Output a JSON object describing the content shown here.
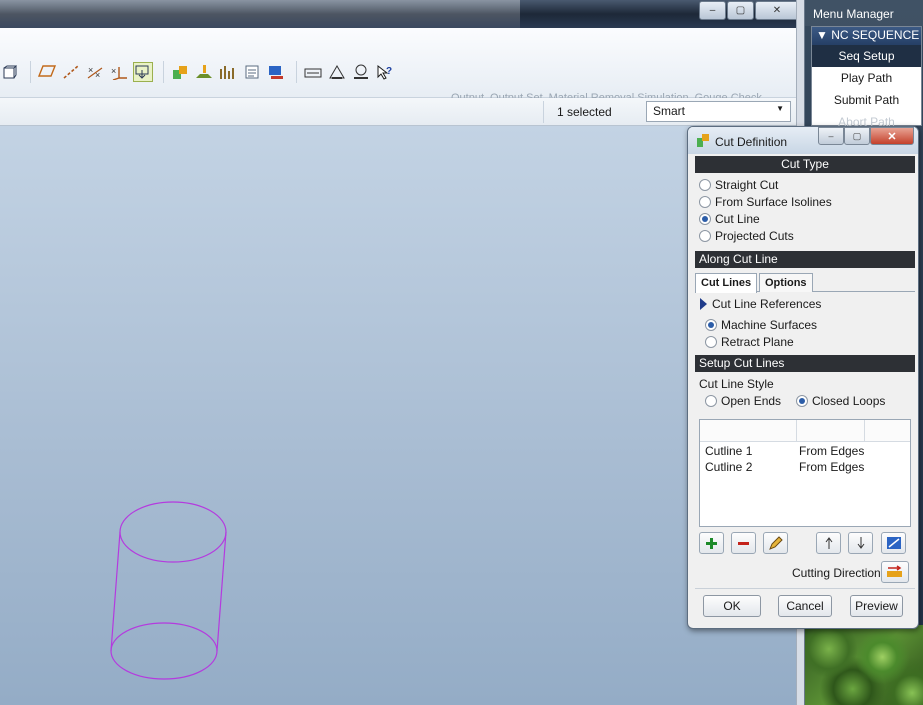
{
  "window": {
    "caption_buttons": {
      "minimize": "–",
      "maximize": "▢",
      "close": "✕"
    }
  },
  "toolbar": {
    "links": [
      "Output",
      "Output Set",
      "Material Removal Simulation",
      "Gouge Check"
    ]
  },
  "statusbar": {
    "selected_text": "1 selected",
    "filter_value": "Smart"
  },
  "menu_manager": {
    "title": "Menu Manager",
    "sequence_header": "NC SEQUENCE",
    "items": [
      {
        "label": "Seq Setup"
      },
      {
        "label": "Play Path"
      },
      {
        "label": "Submit Path"
      },
      {
        "label": "Abort Path"
      }
    ]
  },
  "dialog": {
    "title": "Cut Definition",
    "cut_type_header": "Cut Type",
    "cut_type_options": [
      "Straight Cut",
      "From Surface Isolines",
      "Cut Line",
      "Projected Cuts"
    ],
    "cut_type_selected": "Cut Line",
    "along_header": "Along Cut Line",
    "tabs": [
      "Cut Lines",
      "Options"
    ],
    "active_tab": "Cut Lines",
    "references_label": "Cut Line References",
    "ref_options": [
      "Machine Surfaces",
      "Retract Plane"
    ],
    "ref_selected": "Machine Surfaces",
    "setup_header": "Setup Cut Lines",
    "style_label": "Cut Line Style",
    "style_options": [
      "Open Ends",
      "Closed Loops"
    ],
    "style_selected": "Closed Loops",
    "cutlines": [
      {
        "name": "Cutline 1",
        "source": "From Edges"
      },
      {
        "name": "Cutline 2",
        "source": "From Edges"
      }
    ],
    "cutting_direction_label": "Cutting Direction",
    "buttons": {
      "ok": "OK",
      "cancel": "Cancel",
      "preview": "Preview"
    }
  },
  "colors": {
    "cylinder": "#b43adf",
    "section_header": "#2d3035",
    "radio_selected": "#2c5da8"
  }
}
